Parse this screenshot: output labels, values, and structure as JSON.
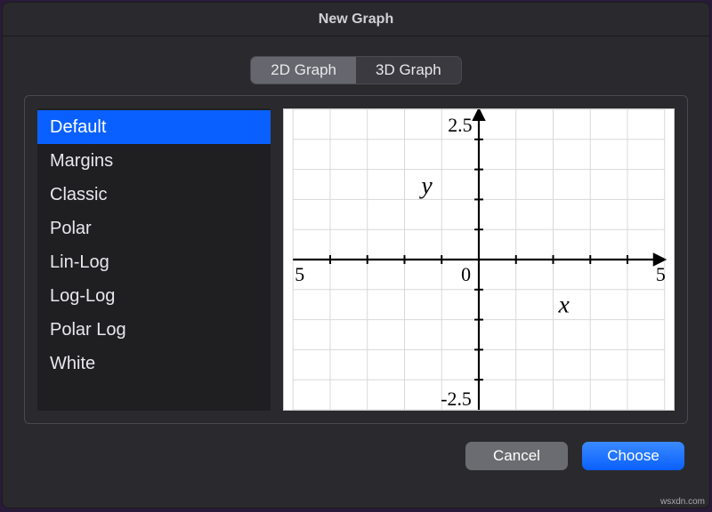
{
  "window": {
    "title": "New Graph"
  },
  "tabs": {
    "two_d": "2D Graph",
    "three_d": "3D Graph",
    "selected": "two_d"
  },
  "templates": {
    "items": [
      "Default",
      "Margins",
      "Classic",
      "Polar",
      "Lin-Log",
      "Log-Log",
      "Polar Log",
      "White"
    ],
    "selected_index": 0
  },
  "preview": {
    "y_axis_label": "y",
    "x_axis_label": "x",
    "y_tick_top": "2.5",
    "y_tick_bottom": "-2.5",
    "x_tick_center": "0",
    "x_tick_left_edge": "5",
    "x_tick_right_edge": "5"
  },
  "buttons": {
    "cancel": "Cancel",
    "choose": "Choose"
  },
  "watermark": "wsxdn.com"
}
